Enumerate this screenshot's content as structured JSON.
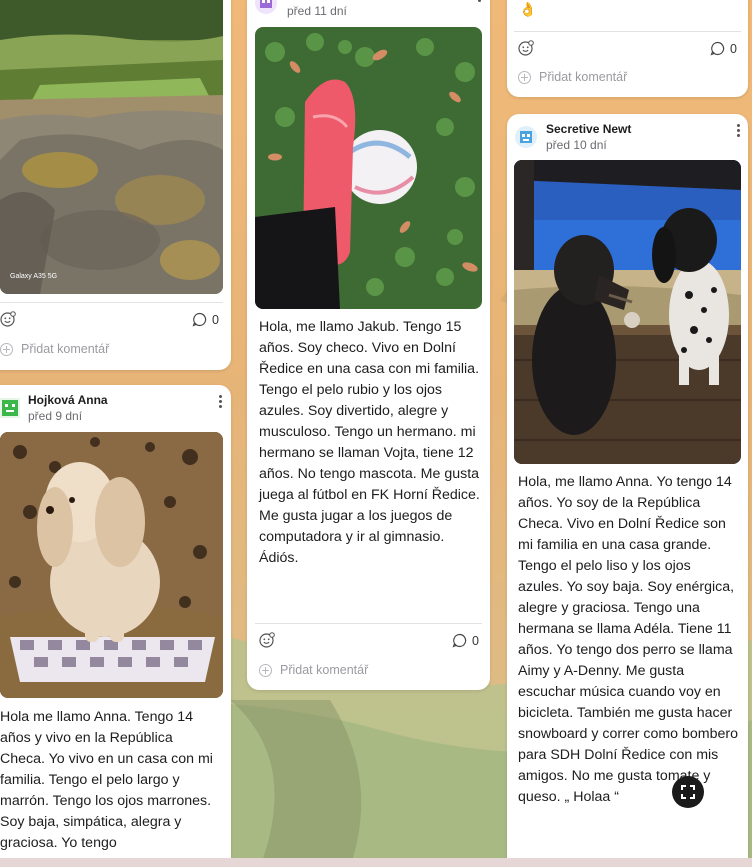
{
  "posts": {
    "landscape": {
      "photo_caption": "Galaxy A35 5G",
      "comment_count": "0",
      "add_comment": "Přidat komentář"
    },
    "jakub": {
      "time": "před 11 dní",
      "text": "Hola, me llamo Jakub. Tengo 15 años. Soy checo. Vivo en Dolní Ředice en una casa con mi familia. Tengo el pelo rubio y los ojos azules. Soy divertido, alegre y musculoso. Tengo un hermano. mi hermano se llaman Vojta, tiene 12 años. No tengo mascota. Me gusta juega al fútbol en FK Horní Ředice. Me gusta jugar a los juegos de computadora y ir al gimnasio. Ádiós.",
      "comment_count": "0",
      "add_comment": "Přidat komentář"
    },
    "hojkova": {
      "author": "Hojková Anna",
      "time": "před 9 dní",
      "text": "Hola me llamo Anna. Tengo 14 años y vivo en la República Checa. Yo vivo en un casa con mi familia. Tengo el pelo largo y marrón. Tengo los ojos marrones. Soy baja, simpática, alegra y graciosa. Yo tengo"
    },
    "top_right": {
      "emoji": "👌",
      "comment_count": "0",
      "add_comment": "Přidat komentář"
    },
    "newt": {
      "author": "Secretive Newt",
      "time": "před 10 dní",
      "text": "Hola, me llamo Anna. Yo tengo 14 años. Yo soy de la República Checa. Vivo en Dolní Ředice son mi familia en una casa grande. Tengo el pelo liso y los ojos azules. Yo soy baja. Soy enérgica, alegre y graciosa. Tengo una hermana se llama Adéla. Tiene 11 años. Yo tengo dos perro se llama Aimy y A-Denny. Me gusta escuchar música cuando voy en bicicleta. También me gusta hacer snowboard y correr como bombero para SDH Dolní Ředice con mis amigos. No me gusta tomate y queso.  „ Holaa “"
    }
  },
  "colors": {
    "card_bg": "#ffffff",
    "muted_text": "#6b6b70",
    "placeholder": "#9a9aa0",
    "avatar_green": "#3cb84a",
    "avatar_purple": "#9b6ad6",
    "avatar_blue": "#4aa3df"
  }
}
